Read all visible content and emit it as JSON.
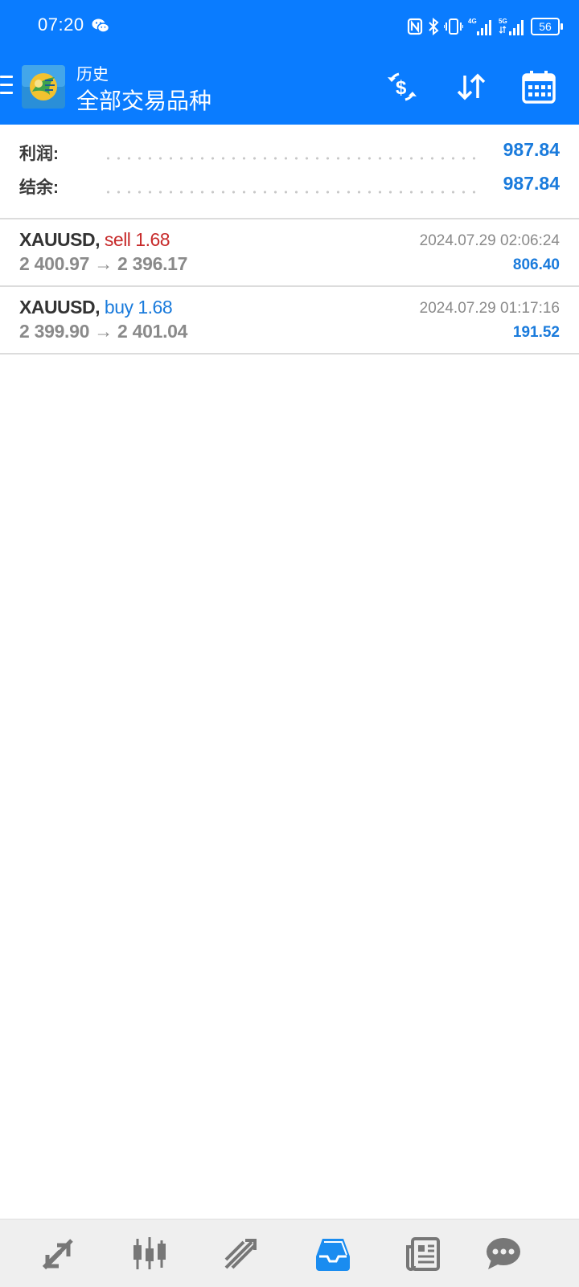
{
  "status_bar": {
    "time": "07:20",
    "battery": "56",
    "icons": [
      "wechat-icon",
      "nfc-icon",
      "bluetooth-icon",
      "vibrate-icon",
      "signal-4g-icon",
      "signal-5g-icon",
      "battery-icon"
    ]
  },
  "app_bar": {
    "subtitle": "历史",
    "title": "全部交易品种",
    "actions": [
      "currency-exchange-icon",
      "sort-icon",
      "calendar-icon"
    ]
  },
  "summary": {
    "profit_label": "利润:",
    "profit_value": "987.84",
    "balance_label": "结余:",
    "balance_value": "987.84"
  },
  "deals": [
    {
      "symbol": "XAUUSD,",
      "side": "sell 1.68",
      "prices": "2 400.97 → 2 396.17",
      "time": "2024.07.29 02:06:24",
      "profit": "806.40"
    },
    {
      "symbol": "XAUUSD,",
      "side": "buy 1.68",
      "prices": "2 399.90 → 2 401.04",
      "time": "2024.07.29 01:17:16",
      "profit": "191.52"
    }
  ],
  "bottom_nav": {
    "items": [
      "quotes-icon",
      "chart-icon",
      "trade-icon",
      "history-icon",
      "news-icon",
      "chat-icon"
    ],
    "active": "history-icon"
  },
  "colors": {
    "primary": "#0a7cff",
    "sell": "#c72b2b",
    "buy": "#1a7bdc",
    "muted": "#8a8a8a"
  }
}
